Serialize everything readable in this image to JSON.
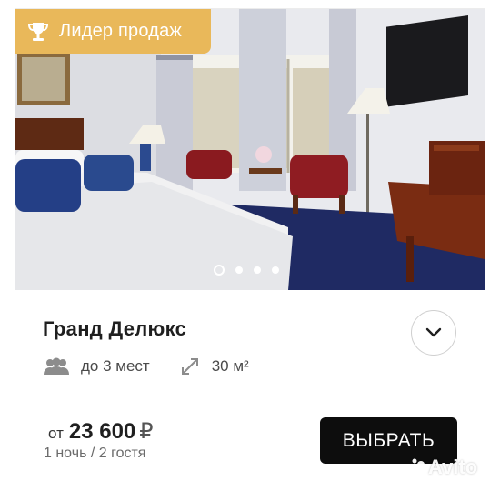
{
  "badge": {
    "label": "Лидер продаж",
    "icon": "trophy-icon",
    "color": "#e9b85a"
  },
  "gallery": {
    "slide_count": 4,
    "active_index": 0
  },
  "room": {
    "title": "Гранд Делюкс",
    "capacity": "до 3 мест",
    "area": "30 м²"
  },
  "price": {
    "from_label": "от",
    "amount": "23 600",
    "currency": "₽",
    "details": "1 ночь / 2 гостя"
  },
  "actions": {
    "select_label": "ВЫБРАТЬ",
    "expand_icon": "chevron-down-icon"
  },
  "watermark": {
    "text": "Avito"
  }
}
